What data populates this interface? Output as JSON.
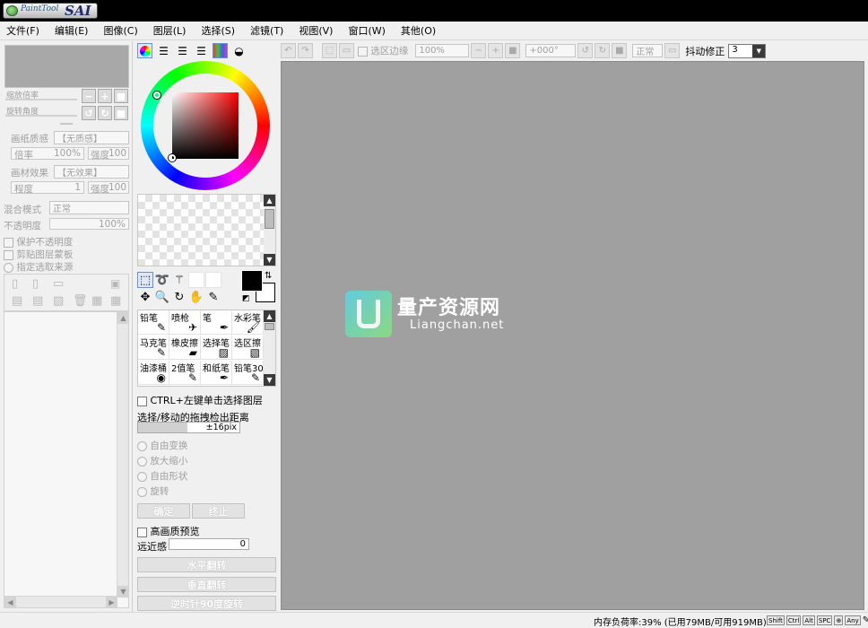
{
  "app": {
    "logo_text": "PaintTool",
    "logo_sai": "SAI"
  },
  "menu": [
    "文件(F)",
    "编辑(E)",
    "图像(C)",
    "图层(L)",
    "选择(S)",
    "滤镜(T)",
    "视图(V)",
    "窗口(W)",
    "其他(O)"
  ],
  "navigator": {
    "zoom_label": "缩放倍率",
    "rotate_label": "旋转角度",
    "paper_texture_label": "画纸质感",
    "paper_texture_value": "【无质感】",
    "pattern_label": "倍率",
    "pattern_value": "100%",
    "strength_label": "强度",
    "strength_value": "100",
    "material_label": "画材效果",
    "material_value": "【无效果】",
    "degree_label": "程度",
    "degree_value": "1",
    "strength2_label": "强度",
    "strength2_value": "100"
  },
  "layer": {
    "blend_label": "混合模式",
    "blend_value": "正常",
    "opacity_label": "不透明度",
    "opacity_value": "100%",
    "protect_opacity": "保护不透明度",
    "clipping_mask": "剪贴图层蒙板",
    "selection_source": "指定选取来源"
  },
  "color": {
    "primary": "#000000",
    "secondary": "#ffffff"
  },
  "brushes": [
    {
      "name": "铅笔",
      "icon": "✎"
    },
    {
      "name": "喷枪",
      "icon": "✈"
    },
    {
      "name": "笔",
      "icon": "✒"
    },
    {
      "name": "水彩笔",
      "icon": "🖌"
    },
    {
      "name": "马克笔",
      "icon": "✎"
    },
    {
      "name": "橡皮擦",
      "icon": "▰"
    },
    {
      "name": "选择笔",
      "icon": "▨"
    },
    {
      "name": "选区擦",
      "icon": "▧"
    },
    {
      "name": "油漆桶",
      "icon": "◉"
    },
    {
      "name": "2值笔",
      "icon": "✎"
    },
    {
      "name": "和纸笔",
      "icon": "✒"
    },
    {
      "name": "铅笔30",
      "icon": "✎"
    }
  ],
  "tool_options": {
    "ctrl_click_label": "CTRL+左键单击选择图层",
    "drag_threshold_label": "选择/移动的拖拽检出距离",
    "drag_threshold_value": "±16pix",
    "free_transform": "自由变换",
    "scale": "放大缩小",
    "free_shape": "自由形状",
    "rotate": "旋转",
    "ok_button": "确定",
    "cancel_button": "终止",
    "hq_preview": "高画质预览",
    "perspective_label": "远近感",
    "perspective_value": "0",
    "flip_h": "水平翻转",
    "flip_v": "垂直翻转",
    "rotate_ccw": "逆时针90度旋转"
  },
  "canvas_toolbar": {
    "selection_edge": "选区边缘",
    "zoom": "100%",
    "angle": "+000°",
    "blend": "正常",
    "stabilizer_label": "抖动修正",
    "stabilizer_value": "3"
  },
  "watermark": {
    "title": "量产资源网",
    "url": "Liangchan.net"
  },
  "status": {
    "memory": "内存负荷率:39% (已用79MB/可用919MB)",
    "keys": [
      "Shift",
      "Ctrl",
      "Alt",
      "SPC",
      "⊕",
      "Any"
    ]
  }
}
